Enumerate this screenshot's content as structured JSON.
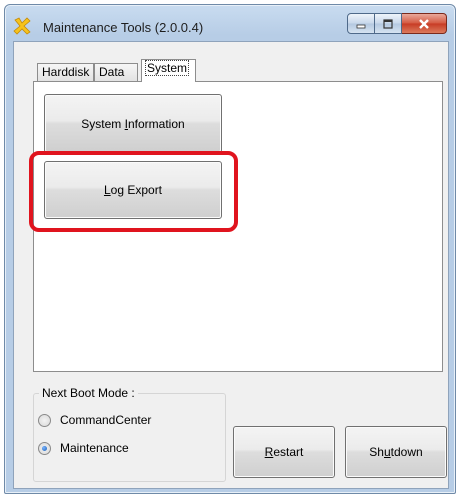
{
  "window": {
    "title": "Maintenance Tools (2.0.0.4)",
    "accent_color": "#e0141e"
  },
  "tabs": [
    {
      "label": "Harddisk",
      "active": false
    },
    {
      "label": "Data",
      "active": false
    },
    {
      "label": "System",
      "active": true
    }
  ],
  "system_panel": {
    "system_info_pre": "System ",
    "system_info_ul": "I",
    "system_info_post": "nformation",
    "log_export_pre": "",
    "log_export_ul": "L",
    "log_export_post": "og Export"
  },
  "boot_mode": {
    "title": "Next Boot Mode :",
    "options": [
      {
        "label": "CommandCenter",
        "checked": false
      },
      {
        "label": "Maintenance",
        "checked": true
      }
    ]
  },
  "actions": {
    "restart_ul": "R",
    "restart_post": "estart",
    "shutdown_pre": "Sh",
    "shutdown_ul": "u",
    "shutdown_post": "tdown"
  },
  "icons": {
    "app": "tools-icon",
    "minimize": "minimize-icon",
    "maximize": "maximize-icon",
    "close": "close-icon"
  }
}
